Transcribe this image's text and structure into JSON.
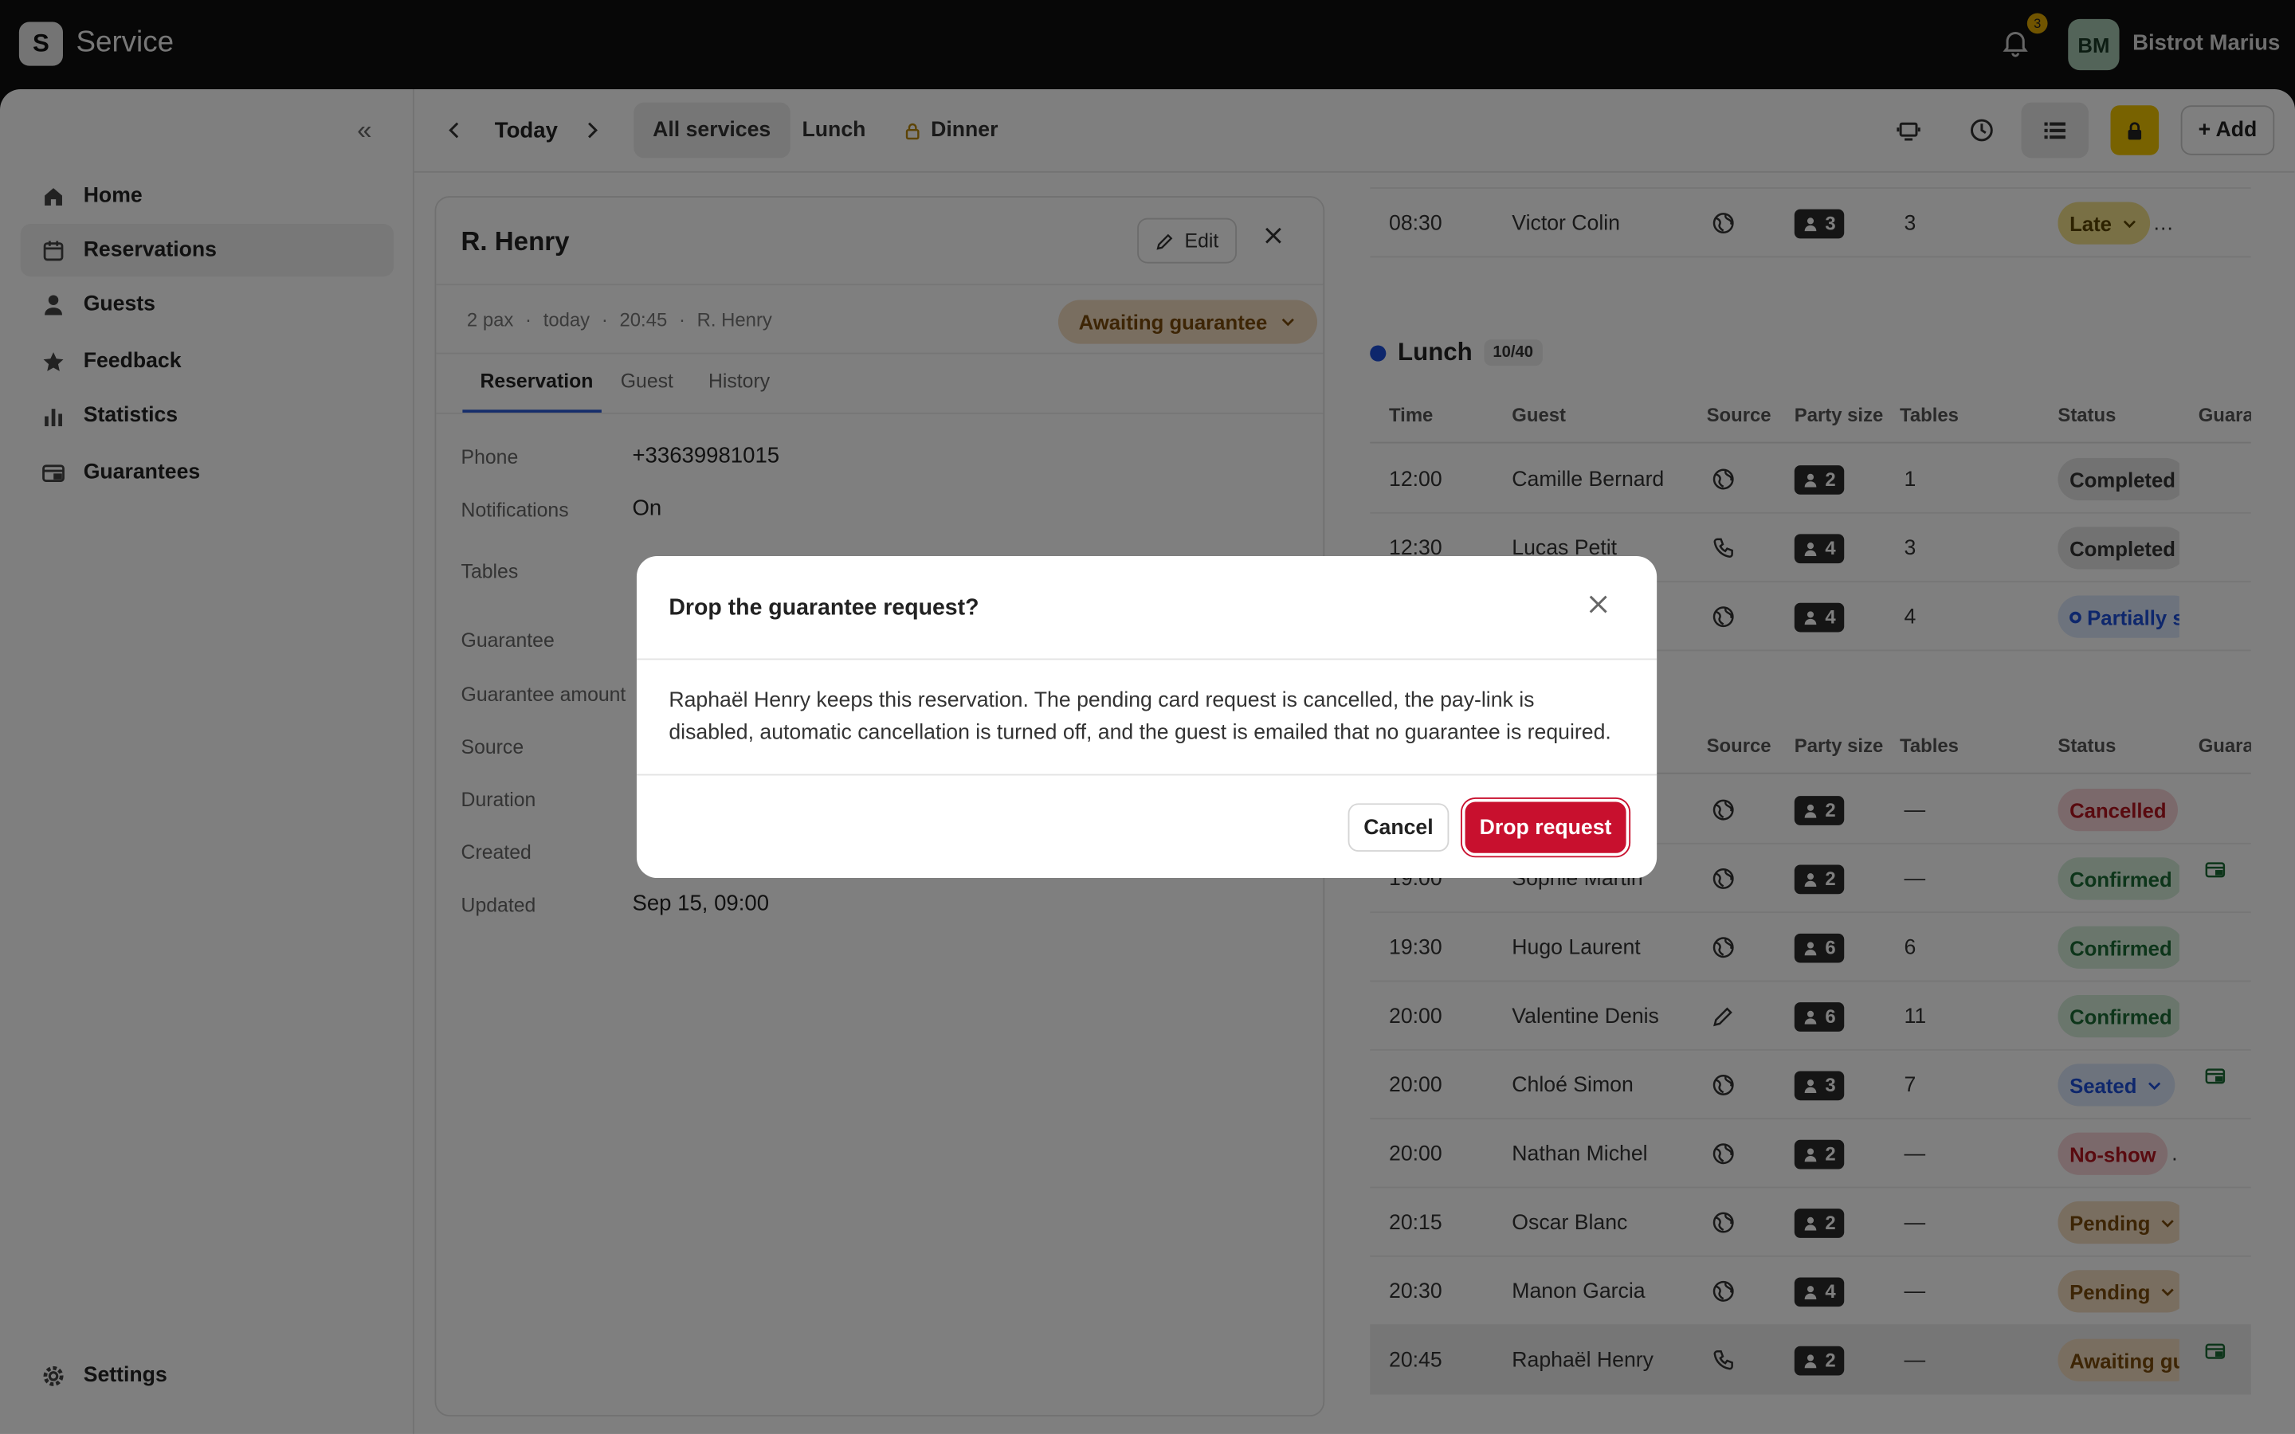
{
  "app": {
    "logo_letter": "S",
    "name": "Service"
  },
  "header": {
    "notification_count": "3",
    "avatar_initials": "BM",
    "restaurant_name": "Bistrot Marius"
  },
  "sidebar": {
    "collapse_glyph": "«",
    "items": [
      {
        "label": "Home",
        "icon": "home-icon"
      },
      {
        "label": "Reservations",
        "icon": "calendar-icon",
        "active": true
      },
      {
        "label": "Guests",
        "icon": "person-icon"
      },
      {
        "label": "Feedback",
        "icon": "star-icon"
      },
      {
        "label": "Statistics",
        "icon": "bar-chart-icon"
      },
      {
        "label": "Guarantees",
        "icon": "card-calendar-icon"
      }
    ],
    "settings": {
      "label": "Settings",
      "icon": "gear-icon"
    }
  },
  "toolbar": {
    "date_label": "Today",
    "service_tabs": [
      {
        "label": "All services",
        "active": true
      },
      {
        "label": "Lunch"
      },
      {
        "label": "Dinner",
        "locked": true
      }
    ],
    "add_label": "+ Add"
  },
  "detail": {
    "title": "R. Henry",
    "edit_label": "Edit",
    "meta": [
      "2 pax",
      "·",
      "today",
      "·",
      "20:45",
      "·",
      "R. Henry"
    ],
    "status": "Awaiting guarantee",
    "tabs": [
      "Reservation",
      "Guest",
      "History"
    ],
    "fields": [
      {
        "label": "Phone",
        "value": "+33639981015"
      },
      {
        "label": "Notifications",
        "value": "On"
      },
      {
        "label": "Tables",
        "value": ""
      },
      {
        "label": "Guarantee",
        "value": ""
      },
      {
        "label": "Guarantee amount",
        "value": ""
      },
      {
        "label": "Source",
        "value": ""
      },
      {
        "label": "Duration",
        "value": ""
      },
      {
        "label": "Created",
        "value": ""
      },
      {
        "label": "Updated",
        "value": "Sep 15, 09:00"
      }
    ]
  },
  "list": {
    "columns": [
      "Time",
      "Guest",
      "Source",
      "Party size",
      "Tables",
      "Status",
      "Guara"
    ],
    "breakfast_rows": [
      {
        "time": "08:30",
        "guest": "Victor Colin",
        "source": "web",
        "party": "3",
        "tables": "3",
        "status": "Late",
        "dropdown": true,
        "extra": "…"
      }
    ],
    "lunch": {
      "name": "Lunch",
      "count": "10/40"
    },
    "lunch_rows": [
      {
        "time": "12:00",
        "guest": "Camille Bernard",
        "source": "web",
        "party": "2",
        "tables": "1",
        "status": "Completed"
      },
      {
        "time": "12:30",
        "guest": "Lucas Petit",
        "source": "phone",
        "party": "4",
        "tables": "3",
        "status": "Completed"
      },
      {
        "time": "",
        "guest": "",
        "source": "web",
        "party": "4",
        "tables": "4",
        "status": "Partially s"
      }
    ],
    "dinner_rows": [
      {
        "time": "",
        "guest": "",
        "source": "web",
        "party": "2",
        "tables": "—",
        "status": "Cancelled",
        "extra": "."
      },
      {
        "time": "19:00",
        "guest": "Sophie Martin",
        "source": "web",
        "party": "2",
        "tables": "—",
        "status": "Confirmed",
        "card": true
      },
      {
        "time": "19:30",
        "guest": "Hugo Laurent",
        "source": "web",
        "party": "6",
        "tables": "6",
        "status": "Confirmed"
      },
      {
        "time": "20:00",
        "guest": "Valentine Denis",
        "source": "pencil",
        "party": "6",
        "tables": "11",
        "status": "Confirmed"
      },
      {
        "time": "20:00",
        "guest": "Chloé Simon",
        "source": "web",
        "party": "3",
        "tables": "7",
        "status": "Seated",
        "dropdown": true,
        "card": true
      },
      {
        "time": "20:00",
        "guest": "Nathan Michel",
        "source": "web",
        "party": "2",
        "tables": "—",
        "status": "No-show",
        "extra": "…"
      },
      {
        "time": "20:15",
        "guest": "Oscar Blanc",
        "source": "web",
        "party": "2",
        "tables": "—",
        "status": "Pending",
        "dropdown": true
      },
      {
        "time": "20:30",
        "guest": "Manon Garcia",
        "source": "web",
        "party": "4",
        "tables": "—",
        "status": "Pending",
        "dropdown": true
      },
      {
        "time": "20:45",
        "guest": "Raphaël Henry",
        "source": "phone",
        "party": "2",
        "tables": "—",
        "status": "Awaiting gu",
        "card": true,
        "highlight": true
      }
    ]
  },
  "colors": {
    "Late": [
      "#f2e08a",
      "#5a4500"
    ],
    "Completed": [
      "#e4e4e4",
      "#333333"
    ],
    "Partially s": [
      "#dbe7fb",
      "#1d4ed8"
    ],
    "Cancelled": [
      "#f7d3d6",
      "#b3141f"
    ],
    "Confirmed": [
      "#d4ecd9",
      "#1b6b34"
    ],
    "Seated": [
      "#dbe7fb",
      "#1d4ed8"
    ],
    "No-show": [
      "#f7d3d6",
      "#b3141f"
    ],
    "Pending": [
      "#f3dcc1",
      "#7a4a0a"
    ],
    "Awaiting gu": [
      "#f3dcc1",
      "#7a4a0a"
    ],
    "accent": "#c8102e"
  },
  "modal": {
    "title": "Drop the guarantee request?",
    "body": "Raphaël Henry keeps this reservation. The pending card request is cancelled, the pay-link is disabled, automatic cancellation is turned off, and the guest is emailed that no guarantee is required.",
    "cancel_label": "Cancel",
    "confirm_label": "Drop request"
  }
}
